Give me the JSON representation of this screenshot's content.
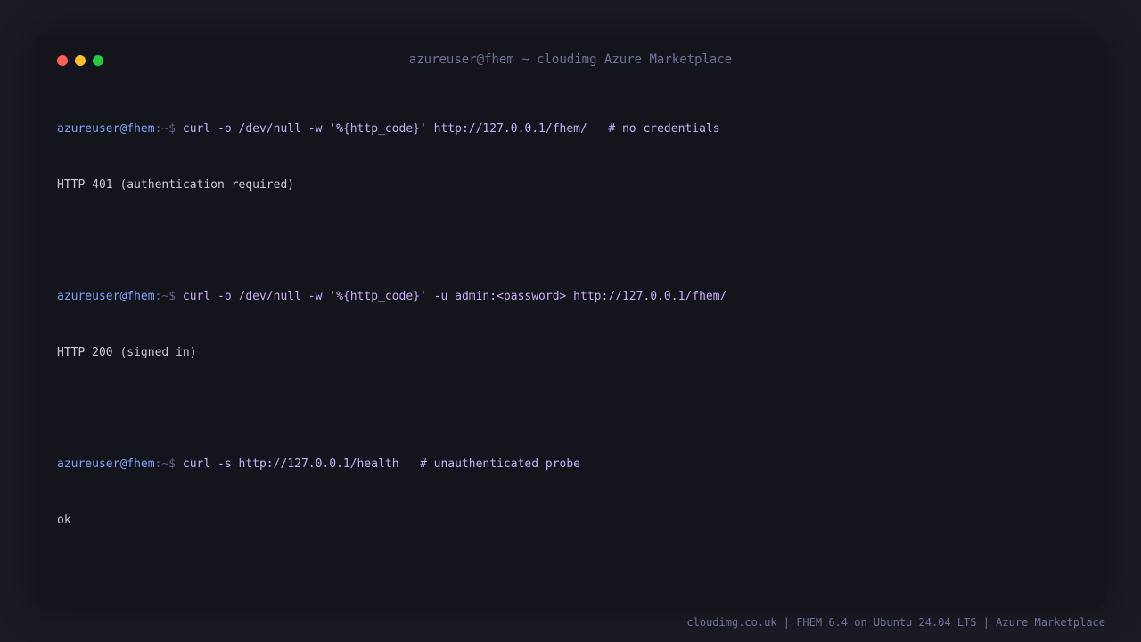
{
  "window": {
    "title": "azureuser@fhem ~ cloudimg Azure Marketplace",
    "controls": [
      {
        "name": "close",
        "color": "#ff5f57"
      },
      {
        "name": "minimize",
        "color": "#febc2e"
      },
      {
        "name": "maximize",
        "color": "#28c840"
      }
    ]
  },
  "terminal": {
    "prompt_user": "azureuser@fhem",
    "prompt_sep": ":~$",
    "blocks": [
      {
        "command": "curl -o /dev/null -w '%{http_code}' http://127.0.0.1/fhem/   # no credentials",
        "output": "HTTP 401 (authentication required)"
      },
      {
        "command": "curl -o /dev/null -w '%{http_code}' -u admin:<password> http://127.0.0.1/fhem/",
        "output": "HTTP 200 (signed in)"
      },
      {
        "command": "curl -s http://127.0.0.1/health   # unauthenticated probe",
        "output": "ok"
      }
    ]
  },
  "footer": {
    "text": "cloudimg.co.uk | FHEM 6.4 on Ubuntu 24.04 LTS | Azure Marketplace"
  },
  "colors": {
    "background": "#1b1b24",
    "terminal_bg": "#14141c",
    "prompt": "#7ea2f5",
    "command": "#c5aef7",
    "output": "#c9cbd4"
  }
}
